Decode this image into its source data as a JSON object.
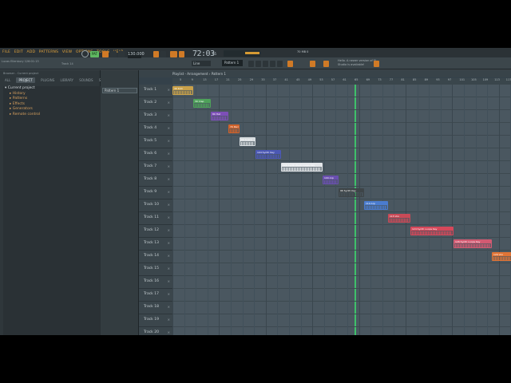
{
  "menu": [
    "FILE",
    "EDIT",
    "ADD",
    "PATTERNS",
    "VIEW",
    "OPTIONS",
    "TOOLS",
    "HELP"
  ],
  "toolbar": {
    "pat_label": "PAT",
    "tempo": "130.000",
    "time": "72:03",
    "time_sub": "05",
    "pattern": "Pattern 1",
    "snap": "Line",
    "hint": "Hello. A newer version of FL Studio is available!",
    "status_left": "Lucas Ellenbury\n126:01:13",
    "track_info": "Track 14",
    "cpu": "70 MB\n0"
  },
  "browser": {
    "header": "Browser - Current project",
    "tabs": [
      "ALL",
      "PROJECT",
      "PLUGINS",
      "LIBRARY",
      "SOUNDS",
      "STARRED"
    ],
    "active_tab": "PROJECT",
    "tree_root": "Current project",
    "tree_items": [
      "History",
      "Patterns",
      "Effects",
      "Generators",
      "Remote control"
    ]
  },
  "picker": {
    "item": "Pattern 1"
  },
  "playlist": {
    "title": "Playlist - Arrangement › Pattern 1",
    "ruler": [
      "5",
      "9",
      "13",
      "17",
      "21",
      "25",
      "29",
      "33",
      "37",
      "41",
      "45",
      "49",
      "53",
      "57",
      "61",
      "65",
      "69",
      "73",
      "77",
      "81",
      "85",
      "89",
      "93",
      "97",
      "101",
      "105",
      "109",
      "113",
      "117",
      "121"
    ],
    "tracks": [
      "Track 1",
      "Track 2",
      "Track 3",
      "Track 4",
      "Track 5",
      "Track 6",
      "Track 7",
      "Track 8",
      "Track 9",
      "Track 10",
      "Track 11",
      "Track 12",
      "Track 13",
      "Track 14",
      "Track 15",
      "Track 16",
      "Track 17",
      "Track 18",
      "Track 19",
      "Track 20"
    ],
    "clips": [
      {
        "title": "40 Kick",
        "row": 0,
        "color": "#c9a14a"
      },
      {
        "title": "30 Clap",
        "row": 1,
        "color": "#4ea25a"
      },
      {
        "title": "80 Hat",
        "row": 2,
        "color": "#7d4fb8"
      },
      {
        "title": "70 Perc",
        "row": 3,
        "color": "#d0622a"
      },
      {
        "title": "60 Snare",
        "row": 4,
        "color": "#d8dde0"
      },
      {
        "title": "104 Synth Key",
        "row": 5,
        "color": "#4b58b5"
      },
      {
        "title": "126 Synth Pluck Loops Key",
        "row": 6,
        "color": "#e4e7ea"
      },
      {
        "title": "100 Arp",
        "row": 7,
        "color": "#6a4fb0"
      },
      {
        "title": "96 Synth Key",
        "row": 8,
        "color": "#3e4548"
      },
      {
        "title": "110 Arp",
        "row": 9,
        "color": "#4a7ccf"
      },
      {
        "title": "115 Vox",
        "row": 10,
        "color": "#c94a57"
      },
      {
        "title": "124 Synth Loops Key",
        "row": 11,
        "color": "#d6485a"
      },
      {
        "title": "126 Synth Loops Key",
        "row": 12,
        "color": "#d25a72"
      },
      {
        "title": "126 Vox",
        "row": 13,
        "color": "#e07436"
      }
    ]
  }
}
